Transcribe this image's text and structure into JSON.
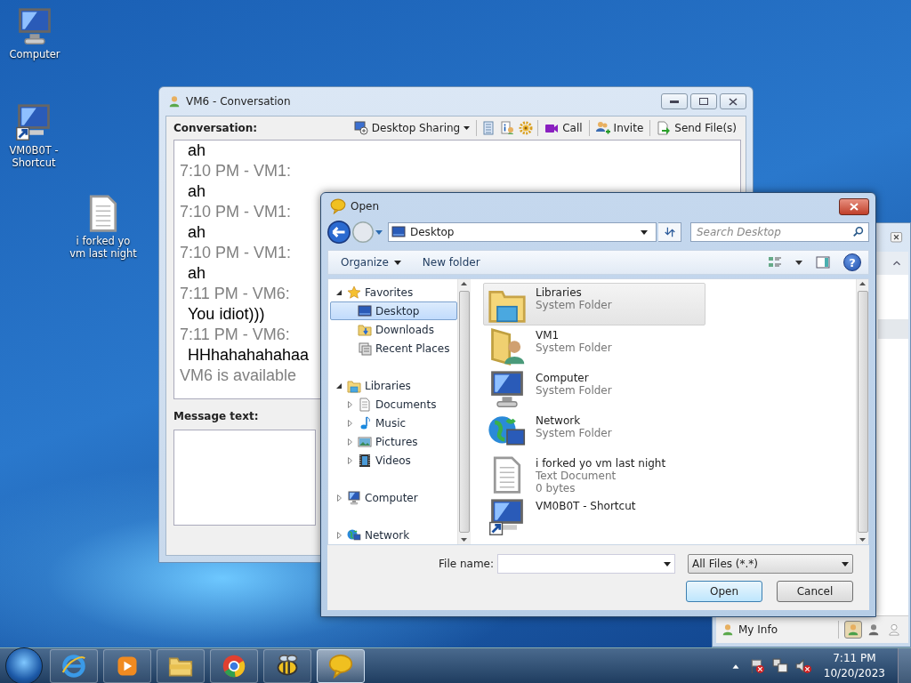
{
  "desktop_icons": [
    {
      "label": "Computer",
      "kind": "computer"
    },
    {
      "label": "VM0B0T - Shortcut",
      "kind": "shortcut"
    },
    {
      "label": "i forked yo vm last night",
      "kind": "document"
    }
  ],
  "conversation_window": {
    "title": "VM6 - Conversation",
    "conversation_label": "Conversation:",
    "toolbar": [
      {
        "kind": "sharing",
        "label": "Desktop Sharing"
      },
      {
        "kind": "notes"
      },
      {
        "kind": "info"
      },
      {
        "kind": "gear"
      },
      {
        "kind": "video",
        "label": "Call"
      },
      {
        "kind": "invite",
        "label": "Invite"
      },
      {
        "kind": "send",
        "label": "Send File(s)"
      }
    ],
    "log": [
      {
        "kind": "message",
        "text": "ah"
      },
      {
        "kind": "sender",
        "text": "7:10 PM - VM1:"
      },
      {
        "kind": "message",
        "text": "ah"
      },
      {
        "kind": "sender",
        "text": "7:10 PM - VM1:"
      },
      {
        "kind": "message",
        "text": "ah"
      },
      {
        "kind": "sender",
        "text": "7:10 PM - VM1:"
      },
      {
        "kind": "message",
        "text": "ah"
      },
      {
        "kind": "sender",
        "text": "7:11 PM - VM6:"
      },
      {
        "kind": "message",
        "text": "You idiot)))"
      },
      {
        "kind": "sender",
        "text": "7:11 PM - VM6:"
      },
      {
        "kind": "message",
        "text": "HHhahahahahaa"
      },
      {
        "kind": "status",
        "text": "VM6 is available"
      }
    ],
    "message_label": "Message text:"
  },
  "contacts_window": {
    "my_info": "My Info",
    "status_buttons": [
      {
        "kind": "available",
        "selected": true
      },
      {
        "kind": "busy",
        "selected": false
      },
      {
        "kind": "offline",
        "selected": false
      }
    ]
  },
  "open_dialog": {
    "title": "Open",
    "address": "Desktop",
    "search": {
      "placeholder": "Search Desktop"
    },
    "toolbar": [
      "Organize",
      "New folder"
    ],
    "help_label": "?",
    "nav_tree": [
      {
        "label": "Favorites",
        "kind": "star",
        "expanded": true,
        "selected": false,
        "children": [
          {
            "label": "Desktop",
            "kind": "desktop",
            "selected": true
          },
          {
            "label": "Downloads",
            "kind": "downloads",
            "selected": false
          },
          {
            "label": "Recent Places",
            "kind": "recent",
            "selected": false
          }
        ]
      },
      {
        "label": "Libraries",
        "kind": "libraries",
        "expanded": true,
        "selected": false,
        "children": [
          {
            "label": "Documents",
            "kind": "documents",
            "expanded": false,
            "selected": false
          },
          {
            "label": "Music",
            "kind": "music",
            "expanded": false,
            "selected": false
          },
          {
            "label": "Pictures",
            "kind": "pictures",
            "expanded": false,
            "selected": false
          },
          {
            "label": "Videos",
            "kind": "videos",
            "expanded": false,
            "selected": false
          }
        ]
      },
      {
        "label": "Computer",
        "kind": "computer",
        "expanded": false,
        "selected": false
      },
      {
        "label": "Network",
        "kind": "network",
        "expanded": false,
        "selected": false
      }
    ],
    "files": [
      {
        "name": "Libraries",
        "type": "System Folder",
        "kind": "libraries",
        "selected": true
      },
      {
        "name": "VM1",
        "type": "System Folder",
        "kind": "user",
        "selected": false
      },
      {
        "name": "Computer",
        "type": "System Folder",
        "kind": "computer",
        "selected": false
      },
      {
        "name": "Network",
        "type": "System Folder",
        "kind": "network",
        "selected": false
      },
      {
        "name": "i forked yo  vm last night",
        "type": "Text Document",
        "size": "0 bytes",
        "kind": "document",
        "selected": false
      },
      {
        "name": "VM0B0T - Shortcut",
        "kind": "shortcut",
        "selected": false
      }
    ],
    "file_name_label": "File name:",
    "file_type": "All Files (*.*)",
    "buttons": [
      "Open",
      "Cancel"
    ]
  },
  "taskbar": {
    "items": [
      {
        "kind": "ie",
        "selected": false
      },
      {
        "kind": "media",
        "selected": false
      },
      {
        "kind": "explorer",
        "selected": false
      },
      {
        "kind": "chrome",
        "selected": false
      },
      {
        "kind": "bee",
        "selected": false
      },
      {
        "kind": "chat",
        "selected": true
      }
    ],
    "time": "7:11 PM",
    "date": "10/20/2023"
  }
}
